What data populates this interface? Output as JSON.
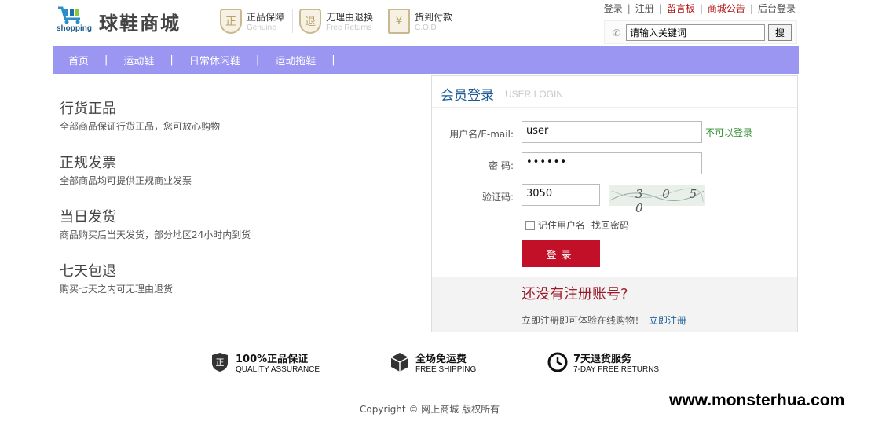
{
  "header": {
    "logo_text": "shopping",
    "site_title": "球鞋商城",
    "guarantees": [
      {
        "icon": "genuine-shield-icon",
        "glyph": "正",
        "main": "正品保障",
        "sub": "Genuine"
      },
      {
        "icon": "returns-shield-icon",
        "glyph": "退",
        "main": "无理由退换",
        "sub": "Free Returns"
      },
      {
        "icon": "cod-icon",
        "glyph": "¥",
        "main": "货到付款",
        "sub": "C.O.D"
      }
    ],
    "top_links": [
      "登录",
      "注册",
      "留言板",
      "商城公告",
      "后台登录"
    ],
    "search_value": "请输入关键词",
    "search_button": "搜"
  },
  "nav": {
    "items": [
      "首页",
      "运动鞋",
      "日常休闲鞋",
      "运动拖鞋"
    ],
    "separator": "|"
  },
  "features": [
    {
      "title": "行货正品",
      "desc": "全部商品保证行货正品，您可放心购物"
    },
    {
      "title": "正规发票",
      "desc": "全部商品均可提供正规商业发票"
    },
    {
      "title": "当日发货",
      "desc": "商品购买后当天发货，部分地区24小时内到货"
    },
    {
      "title": "七天包退",
      "desc": "购买七天之内可无理由退货"
    }
  ],
  "login": {
    "title": "会员登录",
    "subtitle": "USER LOGIN",
    "username_label": "用户名/E-mail:",
    "username_value": "user",
    "username_status": "不可以登录",
    "password_label": "密  码:",
    "password_value": "••••••",
    "captcha_label": "验证码:",
    "captcha_value": "3050",
    "captcha_image_text": "3 0 5 0",
    "remember_label": "记住用户名",
    "forgot_label": "找回密码",
    "submit_label": "登录",
    "register_question": "还没有注册账号?",
    "register_prompt": "立即注册即可体验在线购物！",
    "register_link": "立即注册"
  },
  "badges": [
    {
      "icon": "quality-shield-icon",
      "main": "100%正品保证",
      "sub": "QUALITY ASSURANCE"
    },
    {
      "icon": "box-icon",
      "main": "全场免运费",
      "sub": "FREE SHIPPING"
    },
    {
      "icon": "clock-icon",
      "main": "7天退货服务",
      "sub": "7-DAY FREE RETURNS"
    }
  ],
  "footer": {
    "copyright": "Copyright © 网上商城 版权所有"
  },
  "watermark": "www.monsterhua.com",
  "colors": {
    "nav_bg": "#9b96f2",
    "login_button": "#c21028",
    "accent_blue": "#1f5c96",
    "ok_green": "#2d8d2d"
  }
}
